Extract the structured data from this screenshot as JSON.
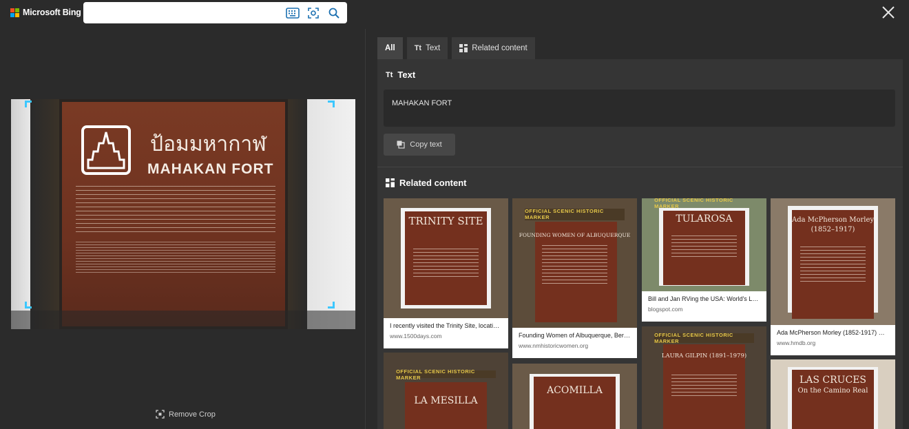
{
  "header": {
    "brand": "Microsoft Bing",
    "brand_colors": [
      "#f25022",
      "#7fba00",
      "#00a4ef",
      "#ffb900"
    ],
    "search_value": "",
    "icons": [
      "keyboard-icon",
      "visual-search-icon",
      "search-icon",
      "close-icon"
    ]
  },
  "left": {
    "sign": {
      "thai_title": "ป้อมมหากาฬ",
      "english_title": "MAHAKAN FORT"
    },
    "remove_crop_label": "Remove Crop",
    "accent": "#3cc7ff"
  },
  "tabs": [
    {
      "label": "All",
      "icon": null,
      "active": true
    },
    {
      "label": "Text",
      "icon": "text-icon",
      "active": false
    },
    {
      "label": "Related content",
      "icon": "grid-icon",
      "active": false
    }
  ],
  "text_section": {
    "heading": "Text",
    "extracted_text": "MAHAKAN FORT",
    "copy_label": "Copy text"
  },
  "related_section": {
    "heading": "Related content",
    "cards": [
      {
        "sign_title": "TRINITY SITE",
        "banner": "",
        "title": "I recently visited the Trinity Site, location...",
        "source": "www.1500days.com"
      },
      {
        "sign_title": "",
        "banner": "OFFICIAL SCENIC HISTORIC MARKER",
        "subtitle": "FOUNDING WOMEN OF ALBUQUERQUE",
        "title": "Founding Women of Albuquerque, Bern...",
        "source": "www.nmhistoricwomen.org"
      },
      {
        "sign_title": "TULAROSA",
        "banner": "OFFICIAL SCENIC HISTORIC MARKER",
        "title": "Bill and Jan RVing the USA: World's Lar...",
        "source": "blogspot.com"
      },
      {
        "sign_title": "Ada McPherson Morley",
        "banner": "",
        "subtitle": "(1852–1917)",
        "title": "Ada McPherson Morley (1852-1917) His...",
        "source": "www.hmdb.org"
      },
      {
        "sign_title": "LA MESILLA",
        "banner": "OFFICIAL SCENIC HISTORIC MARKER",
        "title": "",
        "source": ""
      },
      {
        "sign_title": "ACOMILLA",
        "banner": "",
        "title": "",
        "source": ""
      },
      {
        "sign_title": "LAURA GILPIN (1891–1979)",
        "banner": "OFFICIAL SCENIC HISTORIC MARKER",
        "title": "",
        "source": ""
      },
      {
        "sign_title": "LAS CRUCES",
        "banner": "",
        "subtitle": "On the Camino Real",
        "title": "",
        "source": ""
      }
    ]
  }
}
